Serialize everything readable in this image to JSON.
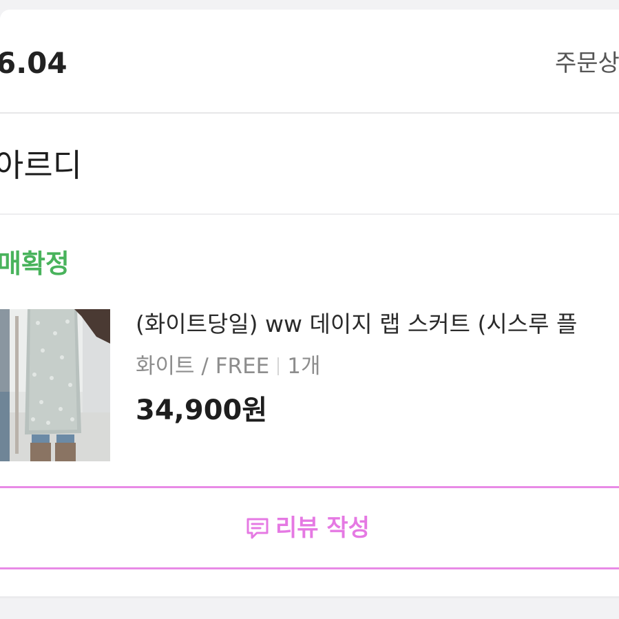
{
  "order": {
    "date": "6.04",
    "status_link": "주문상"
  },
  "seller": {
    "name": "아르디"
  },
  "purchase": {
    "status": "매확정"
  },
  "product": {
    "name": "(화이트당일) ww 데이지 랩 스커트 (시스루 플",
    "option": "화이트 / FREE",
    "quantity": "1개",
    "price": "34,900원"
  },
  "review_button": {
    "label": "리뷰 작성",
    "icon": "chat-bubble-icon",
    "color": "#e579e3"
  },
  "colors": {
    "confirm_green": "#49b35c",
    "review_pink": "#e88ae6"
  }
}
